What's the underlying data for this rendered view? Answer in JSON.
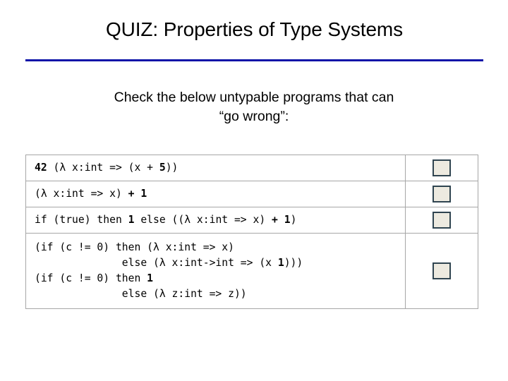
{
  "slide": {
    "title": "QUIZ: Properties of Type Systems",
    "accent_color": "#0d14a8",
    "subtitle_lines": [
      "Check the below untypable programs that can",
      "“go wrong”:"
    ]
  },
  "quiz": {
    "checkbox": {
      "fill_color": "#edeae0",
      "border_color": "#2f4450",
      "checked": false
    },
    "rows": [
      {
        "code_html": "<b>42</b> (λ x:int => (x + <b>5</b>))",
        "code_text": "42 (λ x:int => (x + 5))",
        "checked": false
      },
      {
        "code_html": "(λ x:int => x) <b>+ 1</b>",
        "code_text": "(λ x:int => x) + 1",
        "checked": false
      },
      {
        "code_html": "if (true) then <b>1</b> else ((λ x:int => x) <b>+ 1</b>)",
        "code_text": "if (true) then 1 else ((λ x:int => x) + 1)",
        "checked": false
      },
      {
        "code_html": "(if (c != 0) then (λ x:int => x)\n              else (λ x:int->int => (x <b>1</b>)))\n(if (c != 0) then <b>1</b>\n              else (λ z:int => z))",
        "code_text": "(if (c != 0) then (λ x:int => x)\n              else (λ x:int->int => (x 1)))\n(if (c != 0) then 1\n              else (λ z:int => z))",
        "checked": false
      }
    ]
  }
}
